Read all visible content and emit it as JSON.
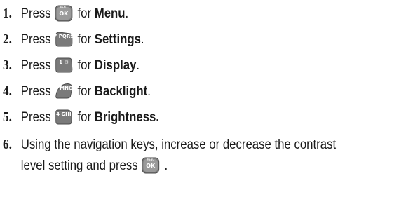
{
  "steps": [
    {
      "number": "1.",
      "prefix": "Press",
      "key": {
        "icon": "menu-ok-key",
        "label": "OK",
        "sub": "MENU"
      },
      "suffix": "for",
      "bold": "Menu",
      "end": "."
    },
    {
      "number": "2.",
      "prefix": "Press",
      "key": {
        "icon": "key-7-pqrs",
        "label": "7 PQRS"
      },
      "suffix": "for",
      "bold": "Settings",
      "end": "."
    },
    {
      "number": "3.",
      "prefix": "Press",
      "key": {
        "icon": "key-1-voicemail",
        "label": "1 ✉"
      },
      "suffix": "for",
      "bold": "Display",
      "end": "."
    },
    {
      "number": "4.",
      "prefix": "Press",
      "key": {
        "icon": "key-6-mno",
        "label": "6 MNO"
      },
      "suffix": "for",
      "bold": "Backlight",
      "end": "."
    },
    {
      "number": "5.",
      "prefix": "Press",
      "key": {
        "icon": "key-4-ghi",
        "label": "4 GHI"
      },
      "suffix": "for",
      "bold": "Brightness.",
      "end": ""
    }
  ],
  "step6": {
    "number": "6.",
    "line1": "Using the navigation keys, increase or decrease the contrast",
    "line2": "level setting and press",
    "key": {
      "icon": "menu-ok-key",
      "label": "OK",
      "sub": "MENU"
    },
    "end": "."
  }
}
